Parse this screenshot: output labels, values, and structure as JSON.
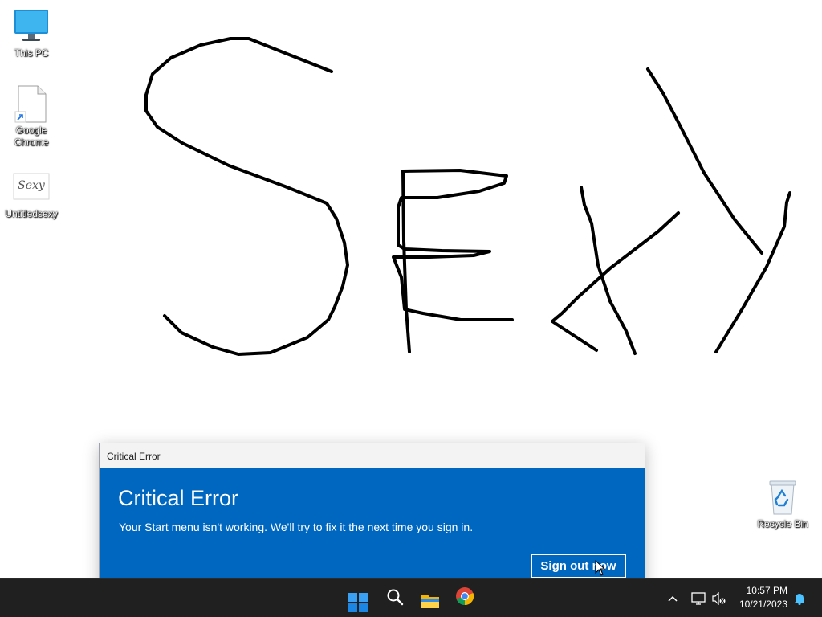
{
  "desktop": {
    "icons": [
      {
        "label": "This PC",
        "icon": "monitor-icon"
      },
      {
        "label": "Google Chrome",
        "label_lines": [
          "Google",
          "Chrome"
        ],
        "icon": "file-shortcut-icon"
      },
      {
        "label": "Untitledsexy",
        "icon": "image-thumbnail-icon",
        "thumbnail_text": "Sexy"
      },
      {
        "label": "Recycle Bin",
        "icon": "recycle-bin-icon"
      }
    ],
    "drawing_text": "Sexy"
  },
  "dialog": {
    "window_title": "Critical Error",
    "heading": "Critical Error",
    "message": "Your Start menu isn't working. We'll try to fix it the next time you sign in.",
    "button_label": "Sign out now",
    "accent_color": "#0067c0"
  },
  "taskbar": {
    "apps": [
      "start-icon",
      "search-icon",
      "file-explorer-icon",
      "chrome-icon"
    ],
    "tray": {
      "icons": [
        "chevron-up-icon",
        "network-icon",
        "volume-muted-icon",
        "notification-bell-icon"
      ],
      "time": "10:57 PM",
      "date": "10/21/2023"
    }
  }
}
